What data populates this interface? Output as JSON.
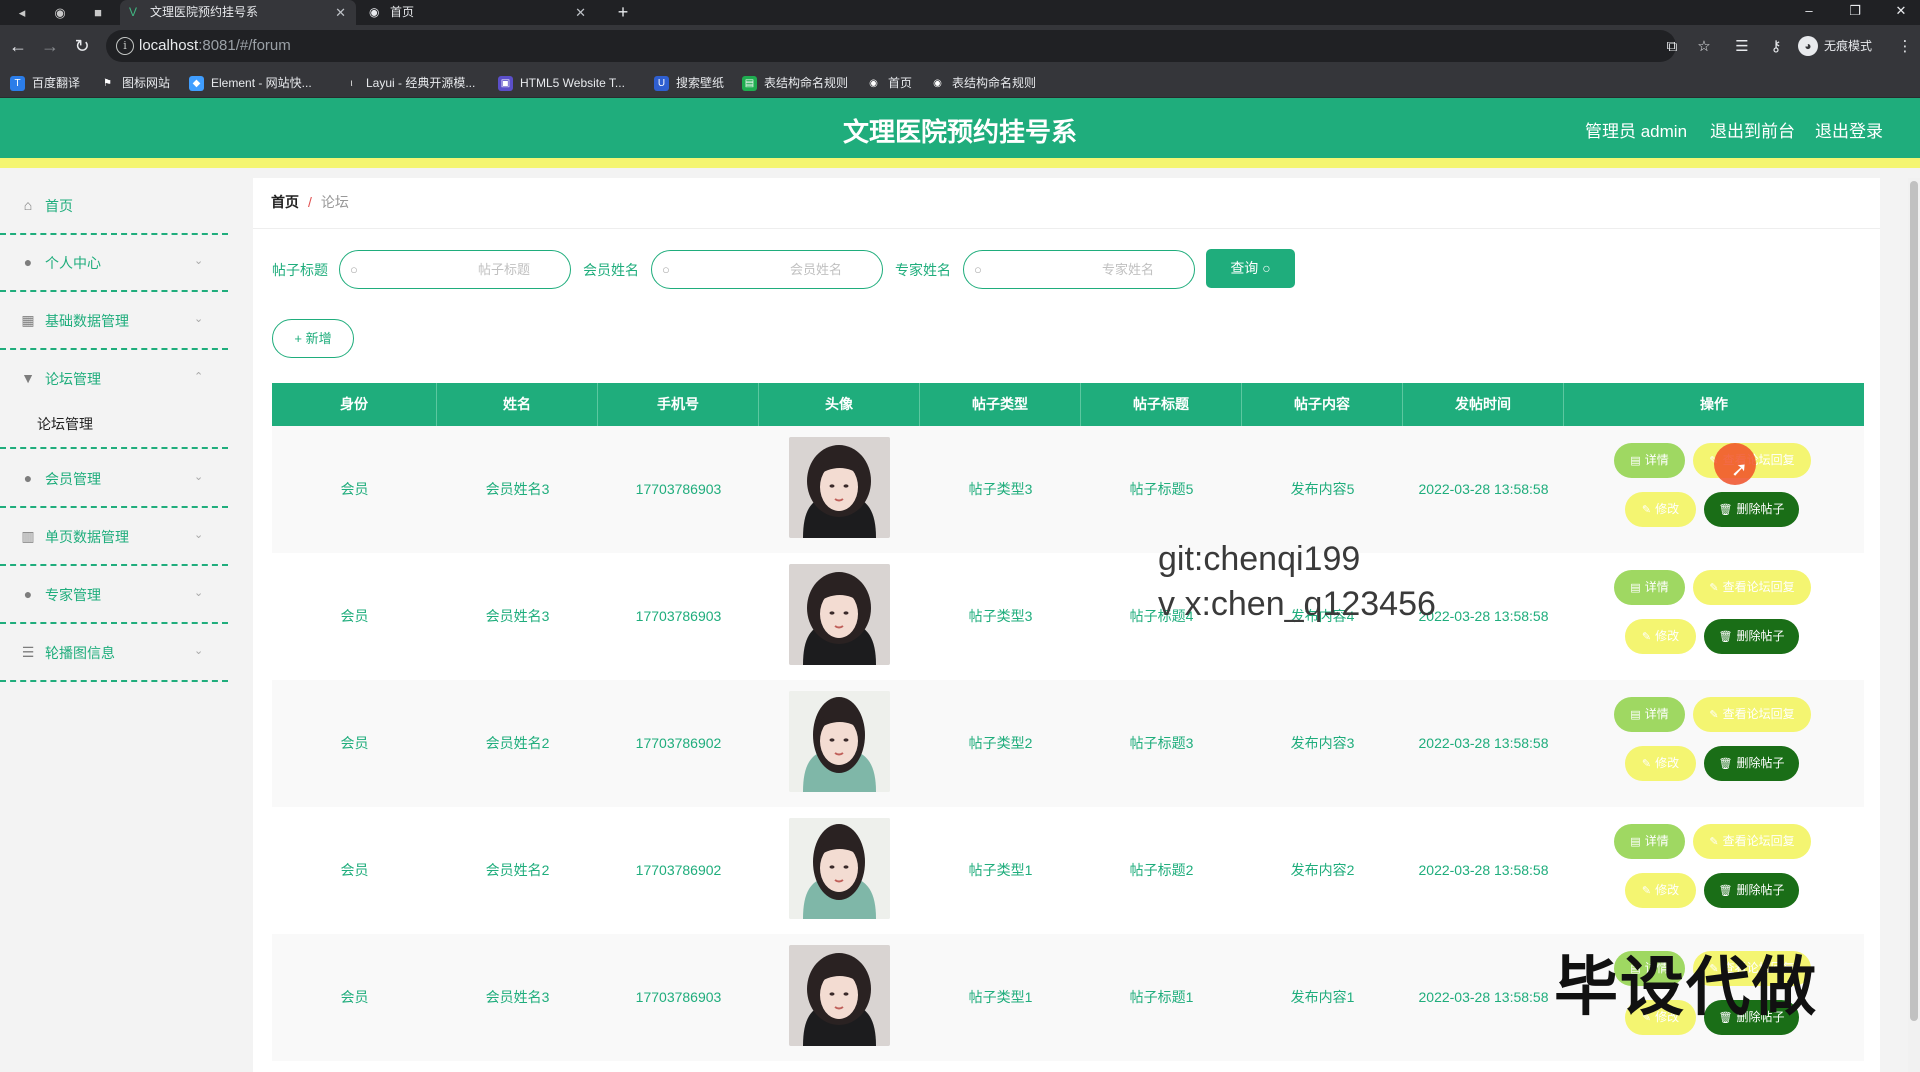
{
  "browser": {
    "tabs": [
      {
        "title": "文理医院预约挂号系",
        "active": true
      },
      {
        "title": "首页",
        "active": false
      }
    ],
    "url_host": "localhost",
    "url_rest": ":8081/#/forum",
    "profile_label": "无痕模式",
    "bookmarks": [
      {
        "label": "百度翻译",
        "icon": "baidu-translate-icon",
        "color": "#2b7de9"
      },
      {
        "label": "图标网站",
        "icon": "flag-icon",
        "color": "#444"
      },
      {
        "label": "Element - 网站快...",
        "icon": "element-icon",
        "color": "#409eff"
      },
      {
        "label": "Layui - 经典开源模...",
        "icon": "layui-icon",
        "color": "#333"
      },
      {
        "label": "HTML5 Website T...",
        "icon": "html5-icon",
        "color": "#5b4fc9"
      },
      {
        "label": "搜索壁纸",
        "icon": "wallpaper-icon",
        "color": "#2f5fd0"
      },
      {
        "label": "表结构命名规则",
        "icon": "table-icon",
        "color": "#1fad50"
      },
      {
        "label": "首页",
        "icon": "globe-icon",
        "color": "#555"
      },
      {
        "label": "表结构命名规则",
        "icon": "globe-icon",
        "color": "#555"
      }
    ]
  },
  "header": {
    "title": "文理医院预约挂号系",
    "admin_label": "管理员 admin",
    "exit_front_label": "退出到前台",
    "logout_label": "退出登录"
  },
  "sidebar": {
    "items": [
      {
        "label": "首页",
        "icon": "home-icon",
        "has_arrow": false
      },
      {
        "label": "个人中心",
        "icon": "user-icon",
        "has_arrow": true
      },
      {
        "label": "基础数据管理",
        "icon": "clipboard-icon",
        "has_arrow": true
      },
      {
        "label": "论坛管理",
        "icon": "thumb-icon",
        "has_arrow": true,
        "expanded": true
      }
    ],
    "sub_item": "论坛管理",
    "items_after": [
      {
        "label": "会员管理",
        "icon": "user-icon",
        "has_arrow": true
      },
      {
        "label": "单页数据管理",
        "icon": "bar-chart-icon",
        "has_arrow": true
      },
      {
        "label": "专家管理",
        "icon": "user-icon",
        "has_arrow": true
      },
      {
        "label": "轮播图信息",
        "icon": "list-icon",
        "has_arrow": true
      }
    ]
  },
  "breadcrumb": {
    "home": "首页",
    "current": "论坛"
  },
  "search": {
    "fields": [
      {
        "label": "帖子标题",
        "placeholder": "帖子标题"
      },
      {
        "label": "会员姓名",
        "placeholder": "会员姓名"
      },
      {
        "label": "专家姓名",
        "placeholder": "专家姓名"
      }
    ],
    "query_label": "查询",
    "add_label": "新增"
  },
  "table": {
    "columns": [
      "身份",
      "姓名",
      "手机号",
      "头像",
      "帖子类型",
      "帖子标题",
      "帖子内容",
      "发帖时间",
      "操作"
    ],
    "rows": [
      {
        "identity": "会员",
        "name": "会员姓名3",
        "phone": "17703786903",
        "avatar_style": "dark",
        "type": "帖子类型3",
        "title": "帖子标题5",
        "content": "发布内容5",
        "time": "2022-03-28 13:58:58"
      },
      {
        "identity": "会员",
        "name": "会员姓名3",
        "phone": "17703786903",
        "avatar_style": "dark",
        "type": "帖子类型3",
        "title": "帖子标题4",
        "content": "发布内容4",
        "time": "2022-03-28 13:58:58"
      },
      {
        "identity": "会员",
        "name": "会员姓名2",
        "phone": "17703786902",
        "avatar_style": "light",
        "type": "帖子类型2",
        "title": "帖子标题3",
        "content": "发布内容3",
        "time": "2022-03-28 13:58:58"
      },
      {
        "identity": "会员",
        "name": "会员姓名2",
        "phone": "17703786902",
        "avatar_style": "light",
        "type": "帖子类型1",
        "title": "帖子标题2",
        "content": "发布内容2",
        "time": "2022-03-28 13:58:58"
      },
      {
        "identity": "会员",
        "name": "会员姓名3",
        "phone": "17703786903",
        "avatar_style": "dark",
        "type": "帖子类型1",
        "title": "帖子标题1",
        "content": "发布内容1",
        "time": "2022-03-28 13:58:58"
      }
    ],
    "actions": {
      "detail": "详情",
      "reply": "查看论坛回复",
      "edit": "修改",
      "delete": "删除帖子"
    }
  },
  "watermarks": {
    "line1": "git:chenqi199",
    "line2": "v x:chen_q123456",
    "stamp": "毕设代做"
  },
  "colors": {
    "primary": "#1fad7c",
    "accent_yellow": "#f4f571",
    "dark_green": "#1a6e17",
    "light_green": "#9fd862"
  }
}
